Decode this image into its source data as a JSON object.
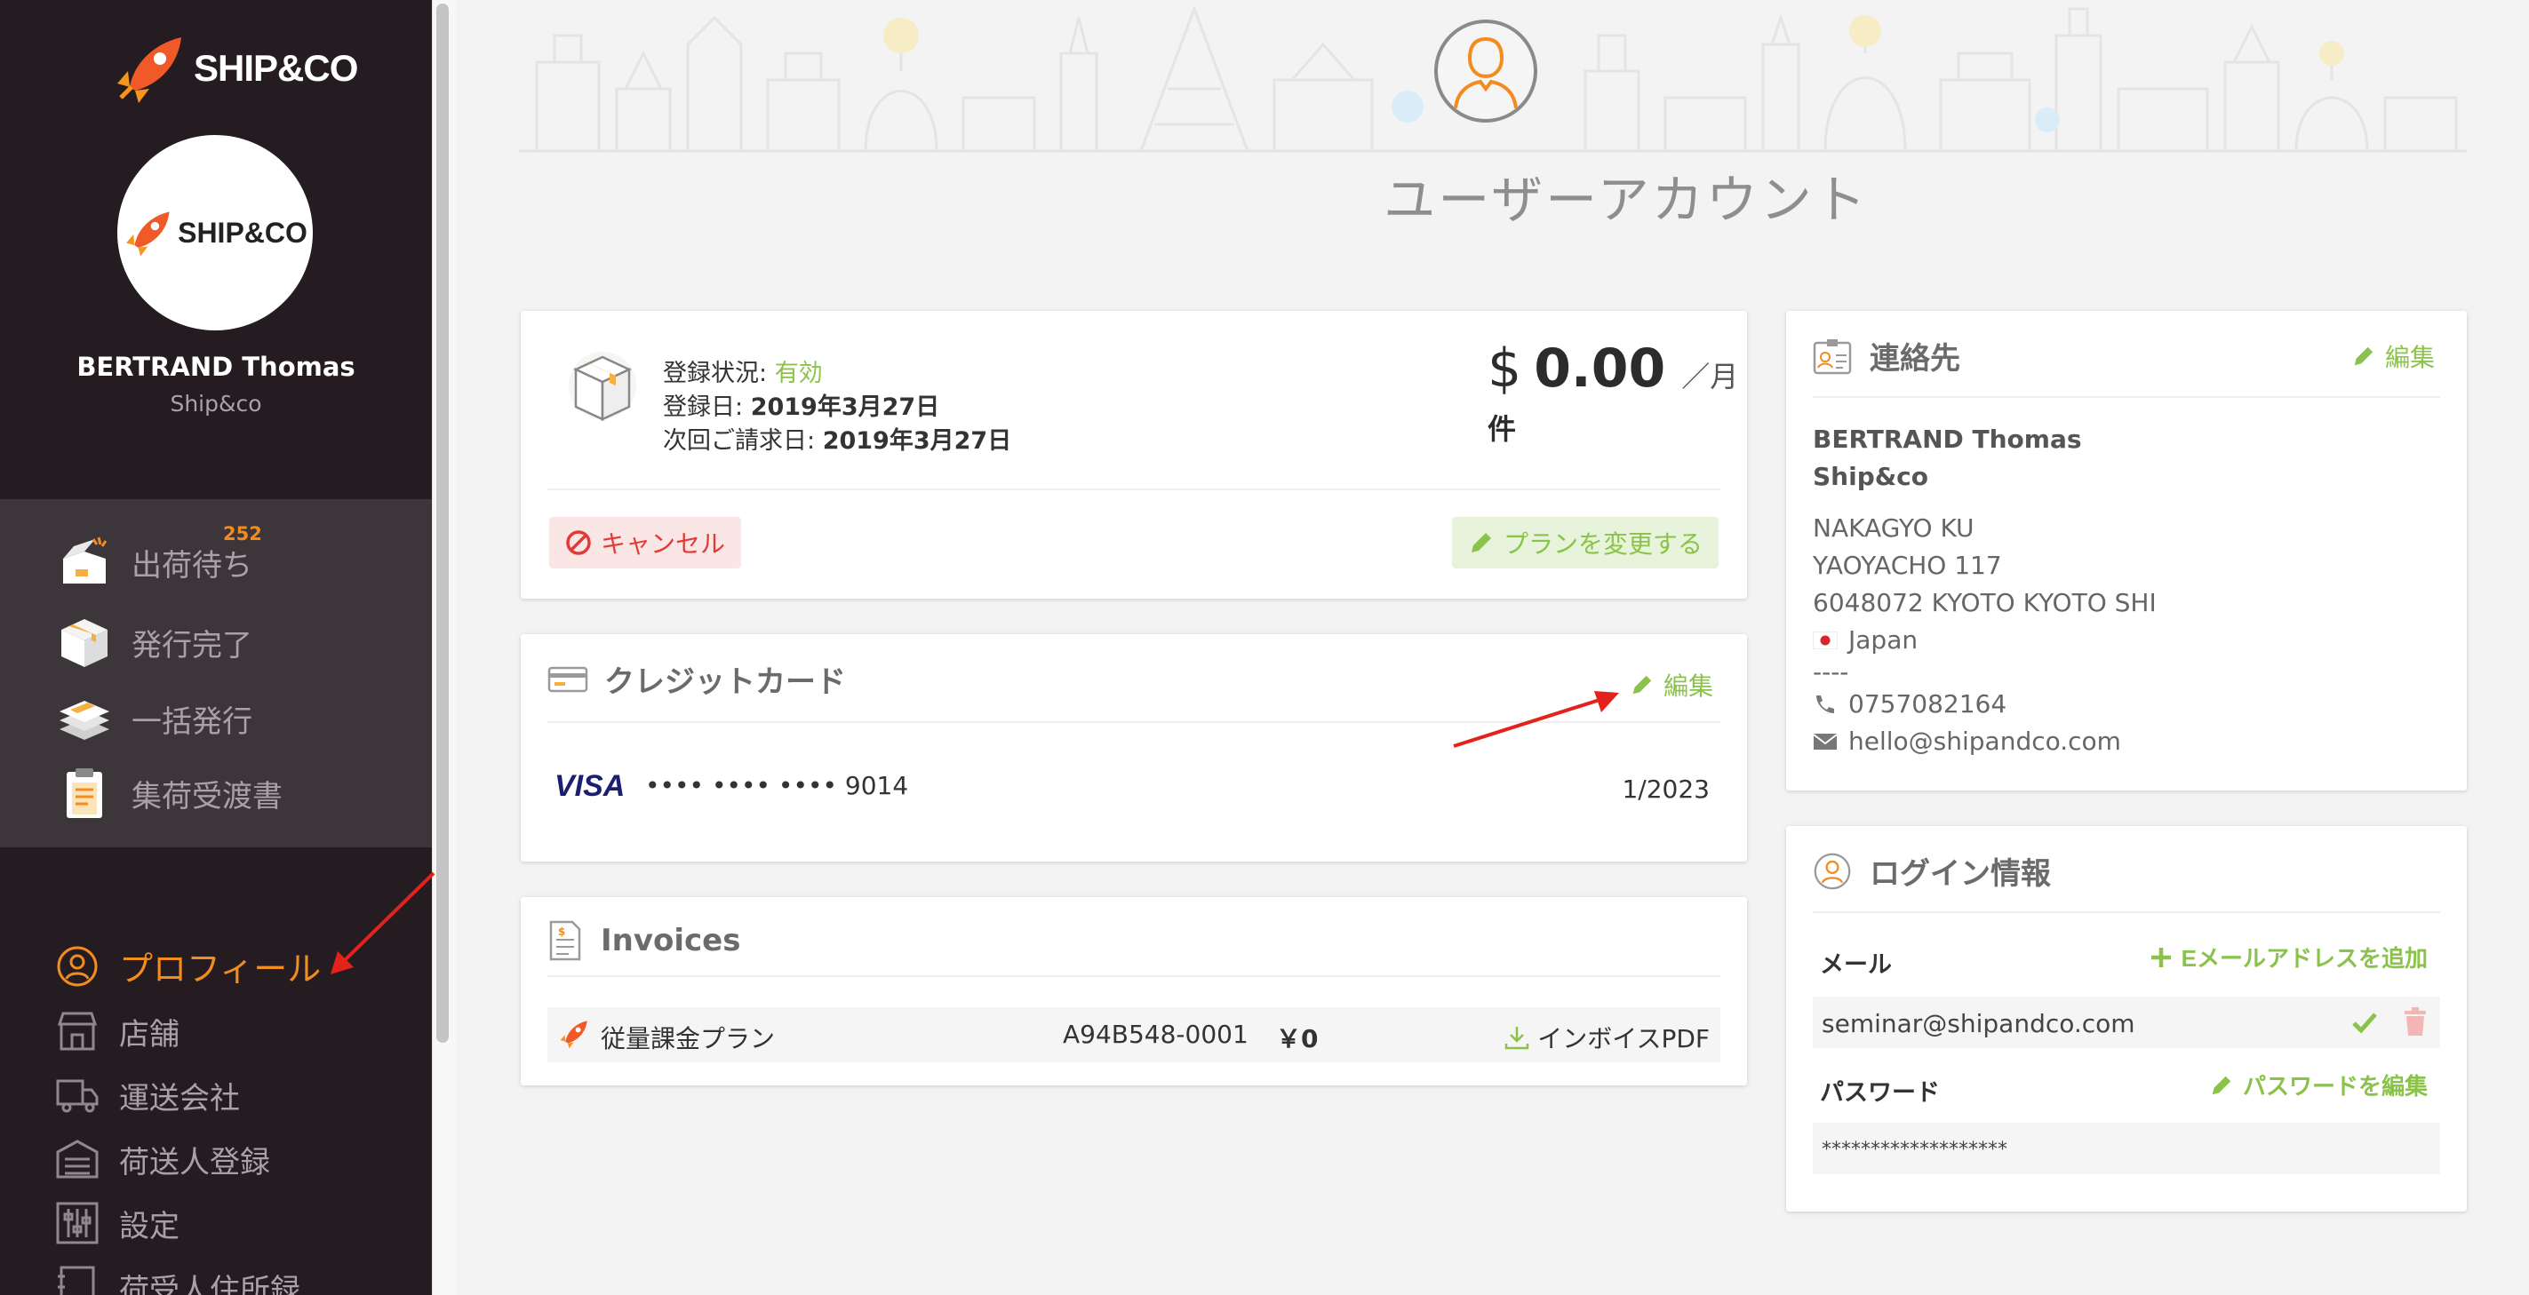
{
  "app": {
    "logo_text": "SHIP&CO",
    "logo_text_small": "SHIP&CO"
  },
  "user": {
    "name": "BERTRAND Thomas",
    "company": "Ship&co"
  },
  "nav_primary": [
    {
      "label": "出荷待ち",
      "icon": "open-box-icon",
      "badge": "252"
    },
    {
      "label": "発行完了",
      "icon": "closed-box-icon"
    },
    {
      "label": "一括発行",
      "icon": "stack-icon"
    },
    {
      "label": "集荷受渡書",
      "icon": "clipboard-icon"
    }
  ],
  "nav_secondary": [
    {
      "label": "プロフィール",
      "icon": "user-icon",
      "active": true
    },
    {
      "label": "店舗",
      "icon": "store-icon"
    },
    {
      "label": "運送会社",
      "icon": "truck-icon"
    },
    {
      "label": "荷送人登録",
      "icon": "warehouse-icon"
    },
    {
      "label": "設定",
      "icon": "sliders-icon"
    },
    {
      "label": "荷受人住所録",
      "icon": "address-book-icon"
    }
  ],
  "page": {
    "title": "ユーザーアカウント"
  },
  "plan": {
    "status_label": "登録状況: ",
    "status_value": "有効",
    "registered_label": "登録日: ",
    "registered_value": "2019年3月27日",
    "next_billing_label": "次回ご請求日: ",
    "next_billing_value": "2019年3月27日",
    "currency": "$",
    "amount": "0.00",
    "per": "／月",
    "unit": "件",
    "cancel_label": "キャンセル",
    "change_label": "プランを変更する"
  },
  "credit_card": {
    "title": "クレジットカード",
    "edit_label": "編集",
    "brand": "VISA",
    "number": "•••• •••• •••• 9014",
    "expiry": "1/2023"
  },
  "invoices": {
    "title": "Invoices",
    "rows": [
      {
        "plan": "従量課金プラン",
        "id": "A94B548-0001",
        "amount": "￥0",
        "pdf_label": "インボイスPDF"
      }
    ]
  },
  "contact": {
    "title": "連絡先",
    "edit_label": "編集",
    "name": "BERTRAND Thomas",
    "company": "Ship&co",
    "address1": "NAKAGYO KU",
    "address2": "YAOYACHO 117",
    "address3": "6048072 KYOTO KYOTO SHI",
    "country": "Japan",
    "separator": "----",
    "phone": "0757082164",
    "email": "hello@shipandco.com"
  },
  "login": {
    "title": "ログイン情報",
    "email_label": "メール",
    "add_email_label": "Eメールアドレスを追加",
    "email_value": "seminar@shipandco.com",
    "password_label": "パスワード",
    "edit_password_label": "パスワードを編集",
    "password_value": "*******************"
  },
  "colors": {
    "accent": "#f28c1e",
    "green": "#8bc34a",
    "red": "#e53935",
    "sidebar": "#241c21"
  }
}
